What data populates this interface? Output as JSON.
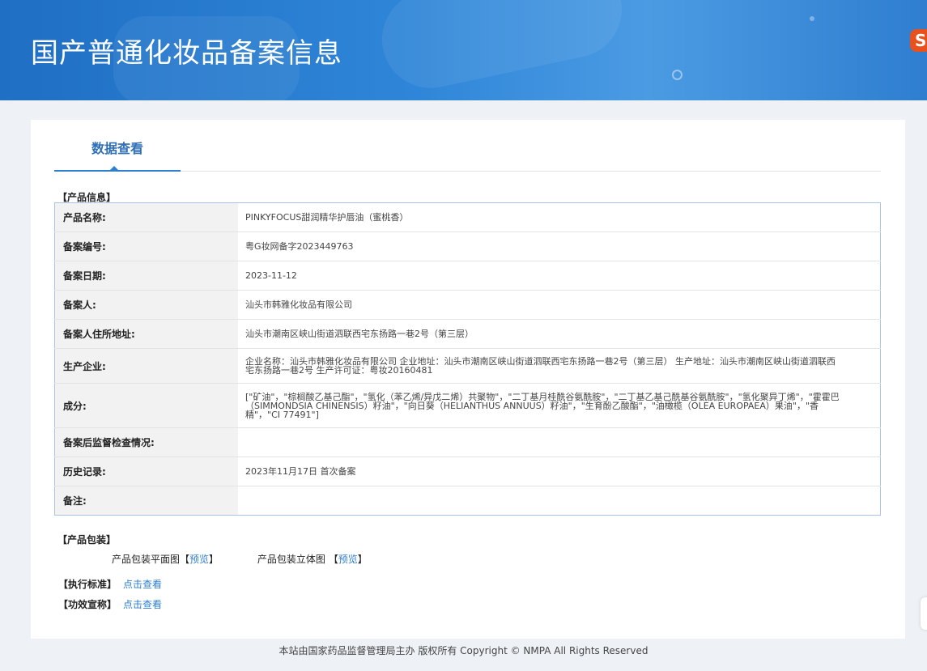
{
  "header": {
    "title": "国产普通化妆品备案信息",
    "logo_text": "S"
  },
  "tabs": [
    {
      "label": "数据查看"
    }
  ],
  "product_info": {
    "section_label": "【产品信息】",
    "rows": [
      {
        "key": "产品名称:",
        "value": "PINKYFOCUS甜润精华护唇油（蜜桃香）"
      },
      {
        "key": "备案编号:",
        "value": "粤G妆网备字2023449763"
      },
      {
        "key": "备案日期:",
        "value": "2023-11-12"
      },
      {
        "key": "备案人:",
        "value": "汕头市韩雅化妆品有限公司"
      },
      {
        "key": "备案人住所地址:",
        "value": "汕头市潮南区峡山街道泗联西宅东扬路一巷2号（第三层）"
      },
      {
        "key": "生产企业:",
        "value": "企业名称：汕头市韩雅化妆品有限公司 企业地址：汕头市潮南区峡山街道泗联西宅东扬路一巷2号（第三层） 生产地址：汕头市潮南区峡山街道泗联西宅东扬路一巷2号 生产许可证：粤妆20160481"
      },
      {
        "key": "成分:",
        "value": "[\"矿油\"，\"棕榈酸乙基己酯\"，\"氢化（苯乙烯/异戊二烯）共聚物\"，\"二丁基月桂酰谷氨酰胺\"，\"二丁基乙基己酰基谷氨酰胺\"，\"氢化聚异丁烯\"，\"霍霍巴（SIMMONDSIA CHINENSIS）籽油\"，\"向日葵（HELIANTHUS ANNUUS）籽油\"，\"生育酚乙酸酯\"，\"油橄榄（OLEA EUROPAEA）果油\"，\"香精\"，\"CI 77491\"]"
      },
      {
        "key": "备案后监督检查情况:",
        "value": ""
      },
      {
        "key": "历史记录:",
        "value": "2023年11月17日 首次备案"
      },
      {
        "key": "备注:",
        "value": ""
      }
    ]
  },
  "packaging": {
    "section_label": "【产品包装】",
    "flat_label": "产品包装平面图",
    "solid_label": "产品包装立体图",
    "bracket_open": "【",
    "bracket_close": "】",
    "preview_link": "预览"
  },
  "standard": {
    "label": "【执行标准】",
    "link": "点击查看"
  },
  "efficacy": {
    "label": "【功效宣称】",
    "link": "点击查看"
  },
  "footer": {
    "text": "本站由国家药品监督管理局主办 版权所有 Copyright © NMPA All Rights Reserved"
  }
}
